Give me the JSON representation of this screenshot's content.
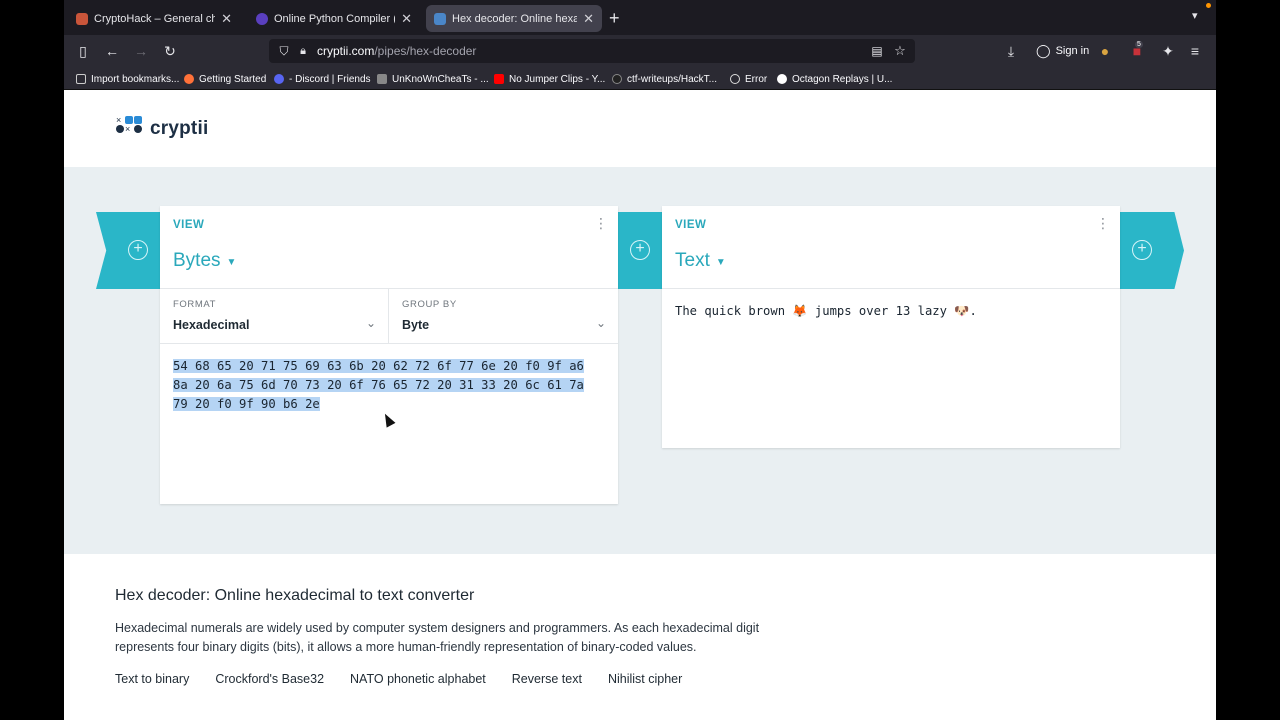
{
  "browser": {
    "tabs": [
      {
        "title": "CryptoHack – General challeng",
        "icon": "cryptohack-favicon",
        "active": false
      },
      {
        "title": "Online Python Compiler (Interp",
        "icon": "programiz-favicon",
        "active": false
      },
      {
        "title": "Hex decoder: Online hexadecim",
        "icon": "cryptii-favicon",
        "active": true
      }
    ],
    "new_tab_label": "+",
    "url_host": "cryptii.com",
    "url_path": "/pipes/hex-decoder",
    "sign_in_label": "Sign in",
    "extension_badge": "5",
    "bookmarks": [
      "Import bookmarks...",
      "Getting Started",
      "- Discord | Friends",
      "UnKnoWnCheaTs - ...",
      "No Jumper Clips - Y...",
      "ctf-writeups/HackT...",
      "Error",
      "Octagon Replays | U..."
    ]
  },
  "site": {
    "logo_text": "cryptii"
  },
  "pipe": {
    "left_view": {
      "label": "VIEW",
      "name": "Bytes",
      "format_label": "FORMAT",
      "format_value": "Hexadecimal",
      "group_label": "GROUP BY",
      "group_value": "Byte",
      "hex_lines": [
        "54 68 65 20 71 75 69 63 6b 20 62 72 6f 77 6e 20 f0 9f a6",
        "8a 20 6a 75 6d 70 73 20 6f 76 65 72 20 31 33 20 6c 61 7a",
        "79 20 f0 9f 90 b6 2e"
      ]
    },
    "right_view": {
      "label": "VIEW",
      "name": "Text",
      "content": "The quick brown 🦊 jumps over 13 lazy 🐶."
    }
  },
  "article": {
    "title": "Hex decoder: Online hexadecimal to text converter",
    "body": "Hexadecimal numerals are widely used by computer system designers and programmers. As each hexadecimal digit represents four binary digits (bits), it allows a more human-friendly representation of binary-coded values.",
    "related": [
      "Text to binary",
      "Crockford's Base32",
      "NATO phonetic alphabet",
      "Reverse text",
      "Nihilist cipher"
    ]
  },
  "colors": {
    "accent": "#2ab6c8",
    "selection": "#b5d4f4",
    "workspace_bg": "#e9eff2"
  }
}
